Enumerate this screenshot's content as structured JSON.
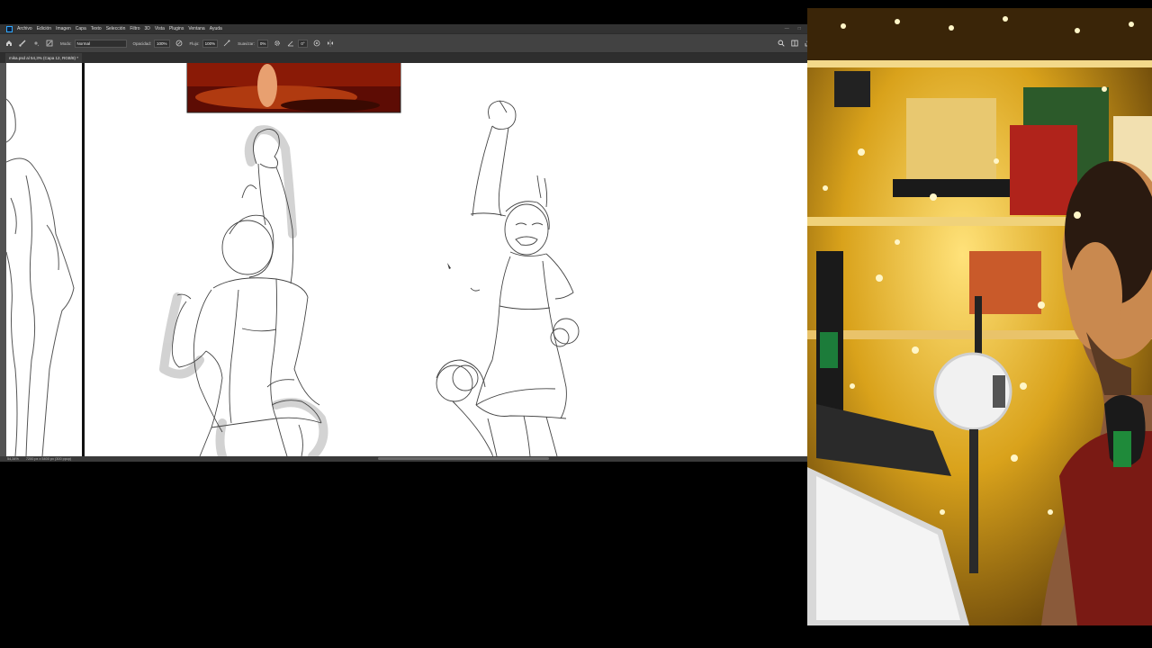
{
  "menu": {
    "items": [
      "Archivo",
      "Edición",
      "Imagen",
      "Capa",
      "Texto",
      "Selección",
      "Filtro",
      "3D",
      "Vista",
      "Plugins",
      "Ventana",
      "Ayuda"
    ]
  },
  "options": {
    "mode_label": "Modo:",
    "mode_value": "Normal",
    "opacity_label": "Opacidad:",
    "opacity_value": "100%",
    "flow_label": "Flujo:",
    "flow_value": "100%",
    "smoothing_label": "Suavizar:",
    "smoothing_value": "0%",
    "angle_value": "0°"
  },
  "document": {
    "tab_title": "mika.psd al 54,3% (Capa 12, RGB/8) *"
  },
  "status": {
    "zoom": "54,34%",
    "doc_size": "7200 px x 5400 px (300 ppcp)"
  },
  "colors": {
    "ps_accent": "#31a8ff",
    "menubar_bg": "#323232",
    "optionsbar_bg": "#424242",
    "canvas_bg": "#ffffff",
    "reference_image": "#7a1204",
    "webcam_warm": "#d9a21b"
  },
  "icons": {
    "home": "home-icon",
    "brush": "brush-icon",
    "brush_settings": "brush-settings-icon",
    "airbrush": "airbrush-icon",
    "pressure": "pressure-icon",
    "gear": "gear-icon",
    "symmetry": "symmetry-icon",
    "search": "search-icon",
    "workspace": "workspace-icon",
    "share": "share-icon"
  }
}
